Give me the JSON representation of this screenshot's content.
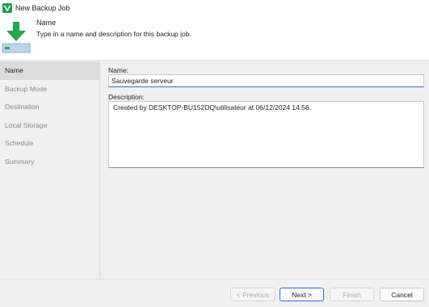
{
  "window": {
    "title": "New Backup Job",
    "icon": "veeam-app-icon",
    "accent": "#1f9d4b"
  },
  "header": {
    "title": "Name",
    "description": "Type in a name and description for this backup job.",
    "icon": "download-arrow-icon"
  },
  "sidebar": {
    "items": [
      {
        "label": "Name",
        "active": true
      },
      {
        "label": "Backup Mode",
        "active": false
      },
      {
        "label": "Destination",
        "active": false
      },
      {
        "label": "Local Storage",
        "active": false
      },
      {
        "label": "Schedule",
        "active": false
      },
      {
        "label": "Summary",
        "active": false
      }
    ]
  },
  "form": {
    "name_label": "Name:",
    "name_value": "Sauvegarde serveur",
    "description_label": "Description:",
    "description_value": "Created by DESKTOP-BU152DQ\\utilisateur at 06/12/2024 14:56."
  },
  "footer": {
    "previous_label": "< Previous",
    "next_label": "Next >",
    "finish_label": "Finish",
    "cancel_label": "Cancel"
  }
}
